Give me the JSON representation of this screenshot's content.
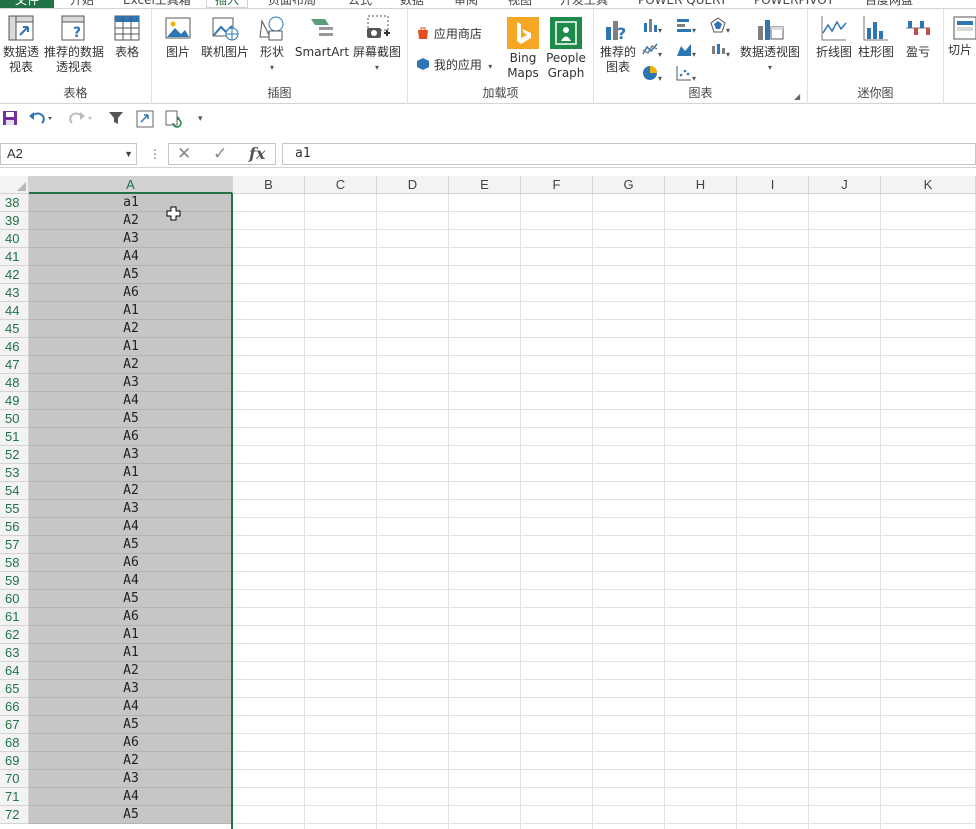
{
  "tabs": [
    "文件",
    "开始",
    "Excel工具箱",
    "插入",
    "页面布局",
    "公式",
    "数据",
    "审阅",
    "视图",
    "开发工具",
    "POWER QUERY",
    "POWERPIVOT",
    "百度网盘"
  ],
  "ribbon": {
    "groups": {
      "tables": {
        "label": "表格",
        "pivot_table": "数据透视表",
        "recommended_pivot": "推荐的数据透视表",
        "table": "表格"
      },
      "illustrations": {
        "label": "插图",
        "picture": "图片",
        "online_picture": "联机图片",
        "shapes": "形状",
        "smartart": "SmartArt",
        "screenshot": "屏幕截图"
      },
      "addins": {
        "label": "加载项",
        "store": "应用商店",
        "my_apps": "我的应用",
        "bing_maps": "Bing Maps",
        "people_graph": "People Graph"
      },
      "charts": {
        "label": "图表",
        "recommended_charts": "推荐的图表",
        "pivot_chart": "数据透视图"
      },
      "sparklines": {
        "label": "迷你图",
        "line": "折线图",
        "column": "柱形图",
        "win_loss": "盈亏"
      },
      "filters": {
        "slicer": "切片"
      }
    }
  },
  "formula_bar": {
    "name_box": "A2",
    "formula": "a1"
  },
  "columns": [
    "A",
    "B",
    "C",
    "D",
    "E",
    "F",
    "G",
    "H",
    "I",
    "J",
    "K"
  ],
  "rows": [
    {
      "n": "38",
      "a": "a1"
    },
    {
      "n": "39",
      "a": "A2"
    },
    {
      "n": "40",
      "a": "A3"
    },
    {
      "n": "41",
      "a": "A4"
    },
    {
      "n": "42",
      "a": "A5"
    },
    {
      "n": "43",
      "a": "A6"
    },
    {
      "n": "44",
      "a": "A1"
    },
    {
      "n": "45",
      "a": "A2"
    },
    {
      "n": "46",
      "a": "A1"
    },
    {
      "n": "47",
      "a": "A2"
    },
    {
      "n": "48",
      "a": "A3"
    },
    {
      "n": "49",
      "a": "A4"
    },
    {
      "n": "50",
      "a": "A5"
    },
    {
      "n": "51",
      "a": "A6"
    },
    {
      "n": "52",
      "a": "A3"
    },
    {
      "n": "53",
      "a": "A1"
    },
    {
      "n": "54",
      "a": "A2"
    },
    {
      "n": "55",
      "a": "A3"
    },
    {
      "n": "56",
      "a": "A4"
    },
    {
      "n": "57",
      "a": "A5"
    },
    {
      "n": "58",
      "a": "A6"
    },
    {
      "n": "59",
      "a": "A4"
    },
    {
      "n": "60",
      "a": "A5"
    },
    {
      "n": "61",
      "a": "A6"
    },
    {
      "n": "62",
      "a": "A1"
    },
    {
      "n": "63",
      "a": "A1"
    },
    {
      "n": "64",
      "a": "A2"
    },
    {
      "n": "65",
      "a": "A3"
    },
    {
      "n": "66",
      "a": "A4"
    },
    {
      "n": "67",
      "a": "A5"
    },
    {
      "n": "68",
      "a": "A6"
    },
    {
      "n": "69",
      "a": "A2"
    },
    {
      "n": "70",
      "a": "A3"
    },
    {
      "n": "71",
      "a": "A4"
    },
    {
      "n": "72",
      "a": "A5"
    }
  ],
  "colors": {
    "accent": "#217346",
    "selection_fill": "#c6c6c6"
  }
}
